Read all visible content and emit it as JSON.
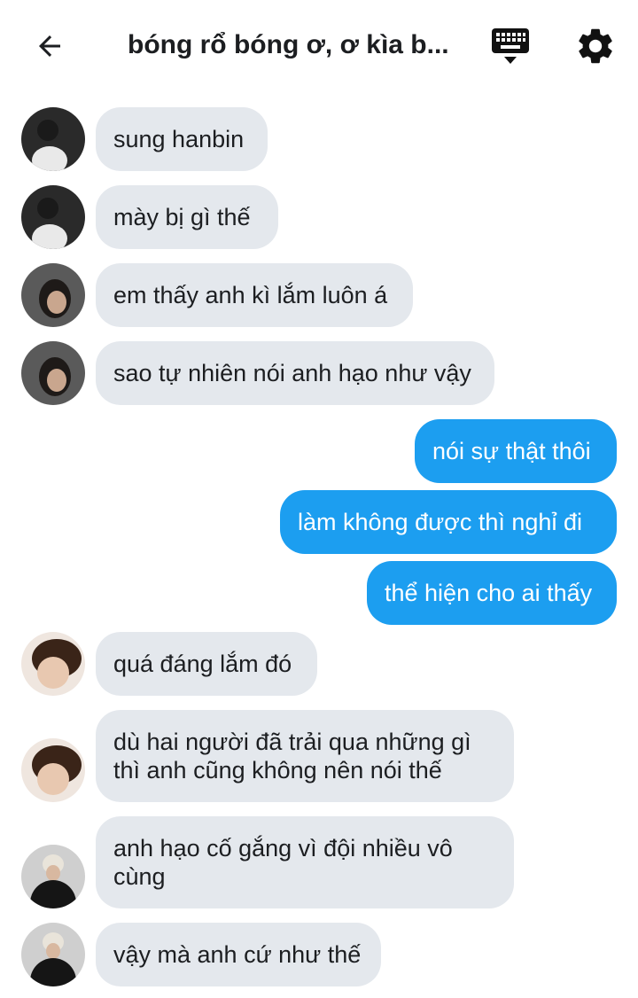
{
  "header": {
    "title": "bóng rổ bóng ơ, ơ kìa b...",
    "back_icon": "arrow-left-icon",
    "keyboard_icon": "keyboard-icon",
    "settings_icon": "gear-icon"
  },
  "colors": {
    "incoming_bubble": "#e4e8ed",
    "outgoing_bubble": "#1c9ef0"
  },
  "messages": [
    {
      "side": "in",
      "avatar": "avatar-1",
      "text": "sung hanbin"
    },
    {
      "side": "in",
      "avatar": "avatar-1",
      "text": "mày bị gì thế"
    },
    {
      "side": "in",
      "avatar": "avatar-2",
      "text": "em thấy anh kì lắm luôn á"
    },
    {
      "side": "in",
      "avatar": "avatar-2",
      "text": "sao tự nhiên nói anh hạo như vậy"
    },
    {
      "side": "out",
      "text": "nói sự thật thôi"
    },
    {
      "side": "out",
      "text": "làm không được thì nghỉ đi"
    },
    {
      "side": "out",
      "text": "thể hiện cho ai thấy"
    },
    {
      "side": "in",
      "avatar": "avatar-3",
      "text": "quá đáng lắm đó"
    },
    {
      "side": "in",
      "avatar": "avatar-3",
      "text": "dù hai người đã trải qua những gì\nthì anh cũng không nên nói thế"
    },
    {
      "side": "in",
      "avatar": "avatar-4",
      "text": "anh hạo cố gắng vì đội nhiều vô\ncùng"
    },
    {
      "side": "in",
      "avatar": "avatar-4",
      "text": "vậy mà anh cứ như thế"
    }
  ]
}
